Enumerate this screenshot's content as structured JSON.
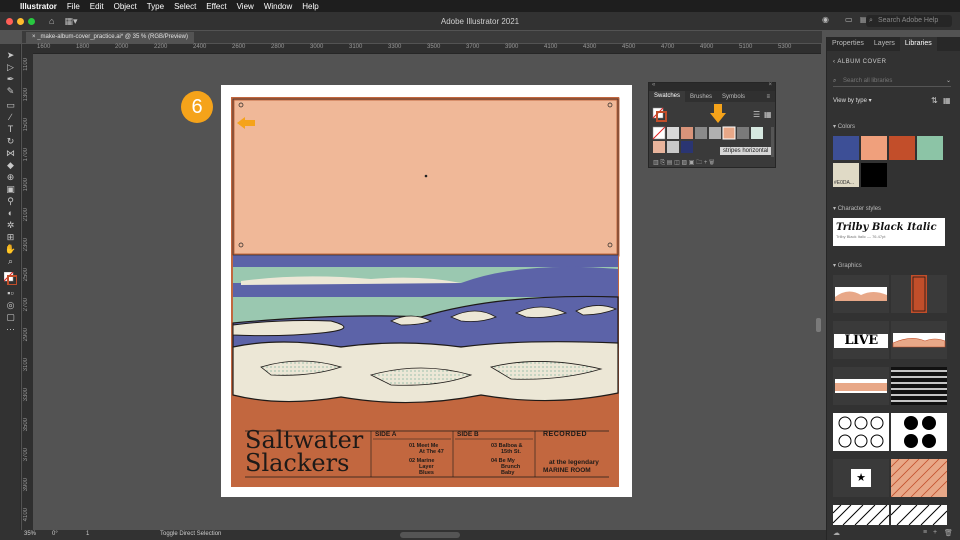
{
  "menubar": {
    "app": "Illustrator",
    "items": [
      "File",
      "Edit",
      "Object",
      "Type",
      "Select",
      "Effect",
      "View",
      "Window",
      "Help"
    ]
  },
  "window": {
    "title": "Adobe Illustrator 2021",
    "search_placeholder": "Search Adobe Help"
  },
  "document": {
    "tab_label": "_make-album-cover_practice.ai* @ 35 % (RGB/Preview)"
  },
  "ruler": {
    "h_ticks": [
      "1600",
      "1800",
      "2000",
      "2200",
      "2400",
      "2600",
      "2800",
      "3000",
      "3100",
      "3300",
      "3500",
      "3700",
      "3900",
      "4100",
      "4300",
      "4500",
      "4700",
      "4900",
      "5100",
      "5300"
    ],
    "v_ticks": [
      "1100",
      "1300",
      "1500",
      "1700",
      "1900",
      "2100",
      "2300",
      "2500",
      "2700",
      "2900",
      "3100",
      "3300",
      "3500",
      "3700",
      "3900",
      "4100"
    ]
  },
  "callout": {
    "number": "6",
    "color": "#f5a31a"
  },
  "album": {
    "title_line1": "Saltwater",
    "title_line2": "Slackers",
    "side_a_label": "SIDE A",
    "side_b_label": "SIDE B",
    "recorded_label": "RECORDED",
    "tracks_a": [
      {
        "num": "01",
        "l1": "Meet Me",
        "l2": "At The 47"
      },
      {
        "num": "02",
        "l1": "Marine",
        "l2": "Layer",
        "l3": "Blues"
      }
    ],
    "tracks_b": [
      {
        "num": "03",
        "l1": "Balboa &",
        "l2": "15th St."
      },
      {
        "num": "04",
        "l1": "Be My",
        "l2": "Brunch",
        "l3": "Baby"
      }
    ],
    "venue_line1": "at the legendary",
    "venue_line2": "MARINE ROOM",
    "colors": {
      "sky": "#f0b898",
      "sand": "#c2673f",
      "ocean": "#5c63a8",
      "foam": "#ece7d6",
      "mint": "#9ac8b0",
      "ink": "#1e1a18"
    }
  },
  "swatches_panel": {
    "tabs": [
      "Swatches",
      "Brushes",
      "Symbols"
    ],
    "active_tab": "Swatches",
    "tooltip": "stripes horizontal"
  },
  "dock": {
    "tabs": [
      "Properties",
      "Layers",
      "Libraries"
    ],
    "active_tab": "Libraries",
    "library_name": "ALBUM COVER",
    "search_placeholder": "Search all libraries",
    "view_by": "View by type",
    "colors_label": "Colors",
    "color_swatches": [
      "#3d4f96",
      "#f0a07c",
      "#c24e2a",
      "#8cc4a6",
      "#e0dac6",
      "#000000"
    ],
    "color_swatch_label": "#E0DA...",
    "char_styles_label": "Character styles",
    "char_style_name": "Trilby Black Italic",
    "char_style_meta": "Trilby Black Italic — 76.47pt",
    "graphics_label": "Graphics",
    "graphic_live": "LIVE"
  },
  "status": {
    "zoom": "35%",
    "angle": "0°",
    "artboard": "1",
    "tool": "Toggle Direct Selection"
  }
}
